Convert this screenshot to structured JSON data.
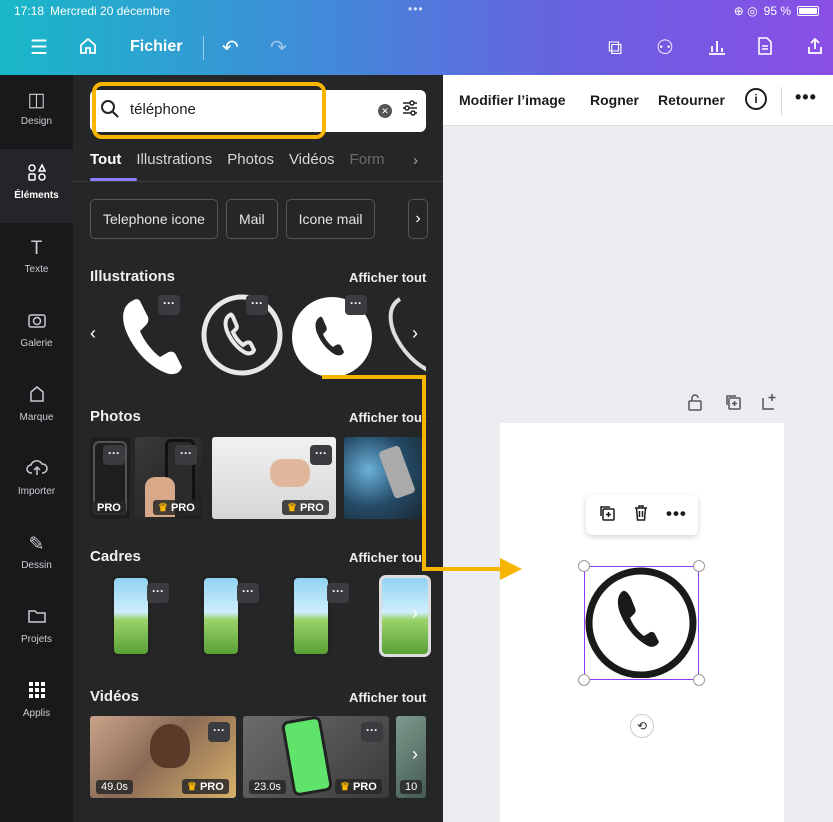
{
  "status": {
    "time": "17:18",
    "date": "Mercredi 20 décembre",
    "dots": "•••",
    "battery": "95 %",
    "indicators": "⊕ ◎"
  },
  "topbar": {
    "fichier": "Fichier"
  },
  "rail": [
    {
      "label": "Design",
      "icon": "layout-icon",
      "glyph": "◫"
    },
    {
      "label": "Éléments",
      "icon": "shapes-icon",
      "glyph": "⌗"
    },
    {
      "label": "Texte",
      "icon": "text-icon",
      "glyph": "T"
    },
    {
      "label": "Galerie",
      "icon": "camera-icon",
      "glyph": "◙"
    },
    {
      "label": "Marque",
      "icon": "brand-icon",
      "glyph": "⌂"
    },
    {
      "label": "Importer",
      "icon": "cloud-upload-icon",
      "glyph": "☁"
    },
    {
      "label": "Dessin",
      "icon": "draw-icon",
      "glyph": "✎"
    },
    {
      "label": "Projets",
      "icon": "folder-icon",
      "glyph": "▭"
    },
    {
      "label": "Applis",
      "icon": "apps-icon",
      "glyph": "⠿"
    }
  ],
  "search": {
    "value": "téléphone",
    "highlight_color": "#f7b500"
  },
  "tabs": [
    "Tout",
    "Illustrations",
    "Photos",
    "Vidéos",
    "Form"
  ],
  "chips": [
    "Telephone icone",
    "Mail",
    "Icone mail"
  ],
  "sections": {
    "illustrations": "Illustrations",
    "photos": "Photos",
    "cadres": "Cadres",
    "videos": "Vidéos",
    "see_all": "Afficher tout"
  },
  "badges": {
    "pro": "PRO",
    "more": "···"
  },
  "videos": [
    {
      "duration": "49.0s"
    },
    {
      "duration": "23.0s"
    },
    {
      "duration": "10"
    }
  ],
  "editor": {
    "edit_image": "Modifier l’image",
    "crop": "Rogner",
    "flip": "Retourner",
    "info": "i",
    "more": "•••"
  },
  "colors": {
    "accent": "#8b3dff",
    "annotation": "#f7b500"
  }
}
